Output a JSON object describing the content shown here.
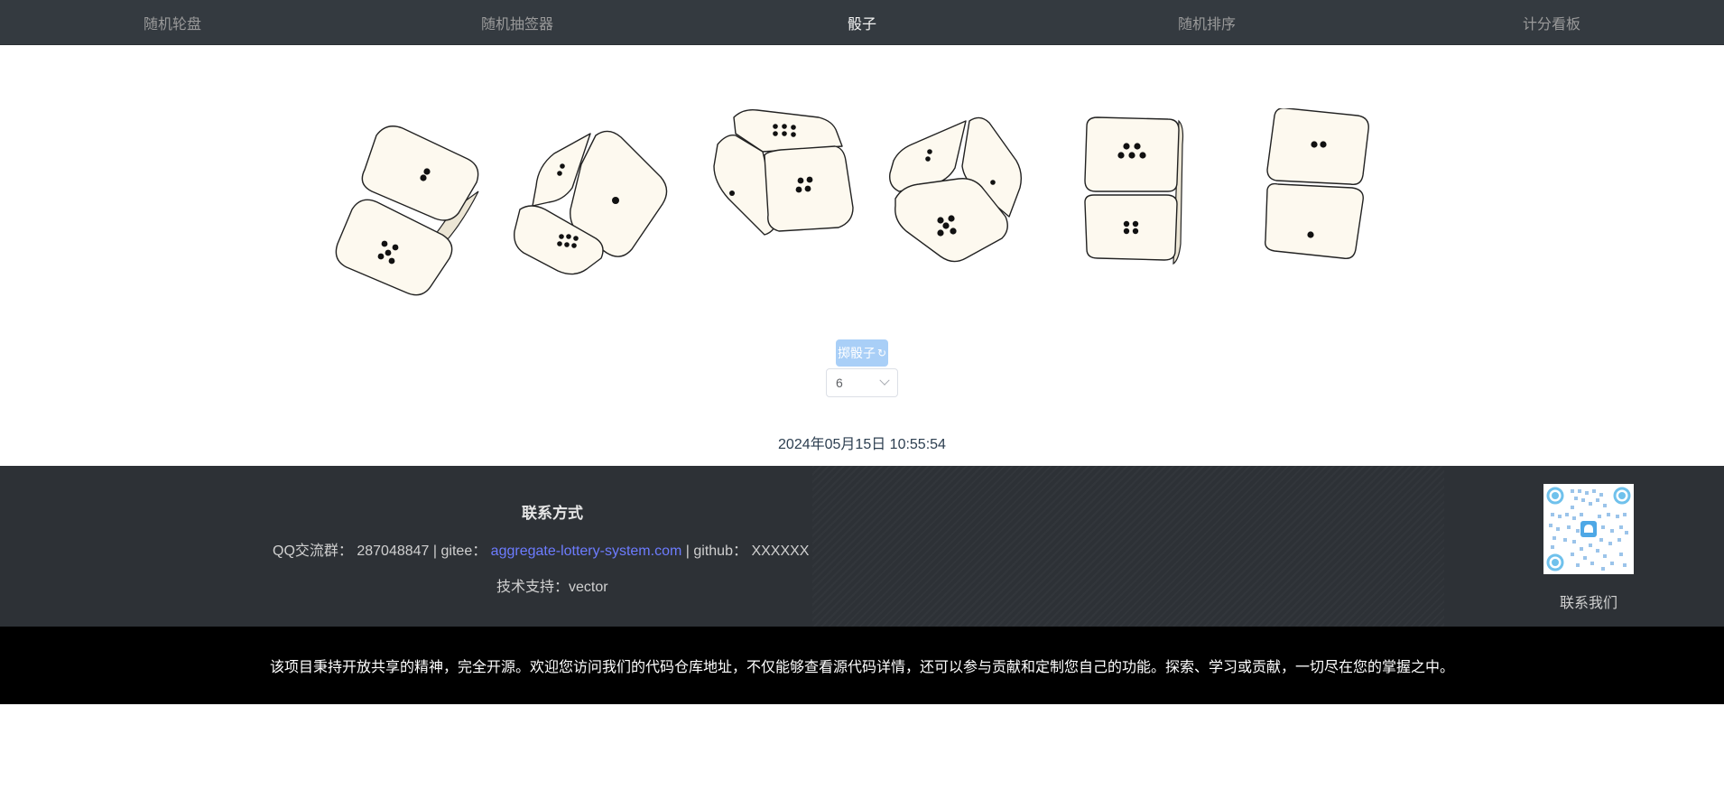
{
  "nav": {
    "tabs": [
      {
        "label": "随机轮盘"
      },
      {
        "label": "随机抽签器"
      },
      {
        "label": "骰子",
        "active": true
      },
      {
        "label": "随机排序"
      },
      {
        "label": "计分看板"
      }
    ]
  },
  "dice": {
    "count": 6
  },
  "controls": {
    "roll_label": "掷骰子",
    "roll_icon": "refresh-icon",
    "count_value": "6"
  },
  "datetime": "2024年05月15日 10:55:54",
  "footer": {
    "contact_title": "联系方式",
    "qq_label": "QQ交流群：",
    "qq_value": "287048847",
    "sep1": " | ",
    "gitee_label": "gitee：",
    "gitee_link": "aggregate-lottery-system.com",
    "sep2": " | ",
    "github_label": "github：",
    "github_value": "XXXXXX",
    "support": "技术支持：vector",
    "qr_label": "联系我们"
  },
  "bottom_text": "该项目秉持开放共享的精神，完全开源。欢迎您访问我们的代码仓库地址，不仅能够查看源代码详情，还可以参与贡献和定制您自己的功能。探索、学习或贡献，一切尽在您的掌握之中。",
  "colors": {
    "nav_bg": "#343a40",
    "footer_bg": "#2d3136",
    "link": "#6d7cff",
    "button_bg": "#a9cff7"
  }
}
